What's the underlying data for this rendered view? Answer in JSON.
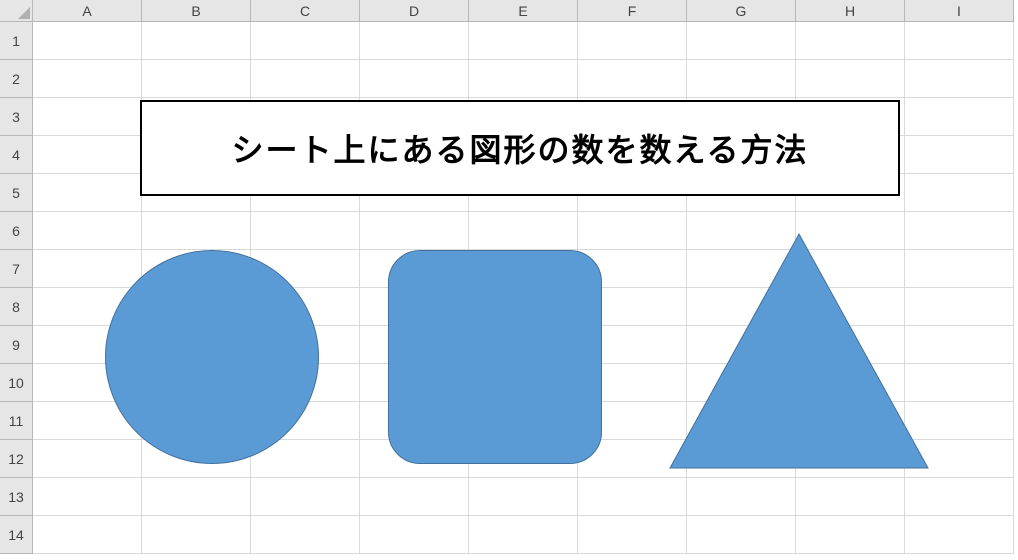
{
  "title_box": {
    "text": "シート上にある図形の数を数える方法"
  },
  "columns": [
    "A",
    "B",
    "C",
    "D",
    "E",
    "F",
    "G",
    "H",
    "I"
  ],
  "rows": [
    "1",
    "2",
    "3",
    "4",
    "5",
    "6",
    "7",
    "8",
    "9",
    "10",
    "11",
    "12",
    "13",
    "14"
  ],
  "shapes": {
    "circle_fill": "#5b9bd5",
    "circle_stroke": "#41719c",
    "roundrect_fill": "#5b9bd5",
    "roundrect_stroke": "#41719c",
    "triangle_fill": "#5b9bd5",
    "triangle_stroke": "#41719c"
  }
}
